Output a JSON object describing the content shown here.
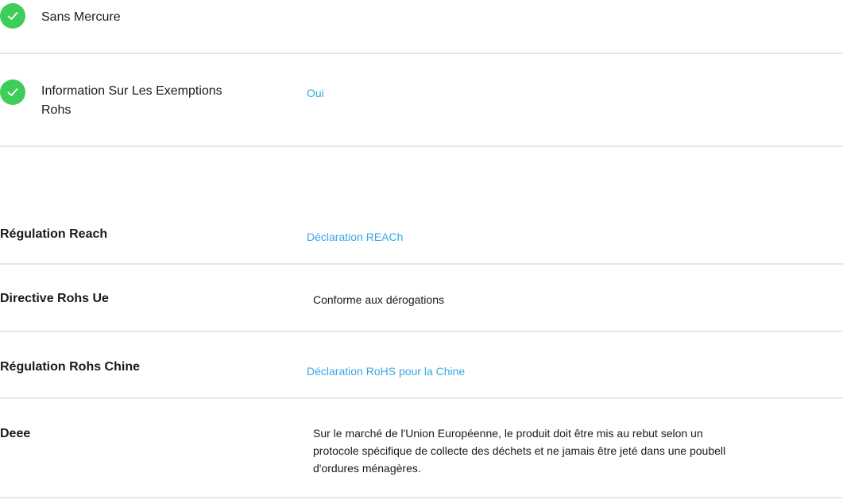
{
  "environment": {
    "items": [
      {
        "label": "Sans Mercure",
        "value": ""
      },
      {
        "label_line1": "Information Sur Les Exemptions",
        "label_line2": "Rohs",
        "value": "Oui"
      }
    ]
  },
  "regulations": {
    "reach": {
      "label": "Régulation Reach",
      "value": "Déclaration REACh"
    },
    "rohs_eu": {
      "label": "Directive Rohs Ue",
      "value": "Conforme aux dérogations"
    },
    "rohs_china": {
      "label": "Régulation Rohs Chine",
      "value": "Déclaration RoHS pour la Chine"
    },
    "weee": {
      "label": "Deee",
      "value_line1": "Sur le marché de l'Union Européenne, le produit doit être mis au rebut selon un",
      "value_line2": "protocole spécifique de collecte des déchets et ne jamais être jeté dans une poubell",
      "value_line3": "d'ordures ménagères."
    }
  },
  "colors": {
    "check_green": "#3dcd58",
    "link_blue": "#3aa7e3",
    "divider": "#e6e6e6"
  },
  "icons": {
    "check": "check-circle-icon"
  }
}
